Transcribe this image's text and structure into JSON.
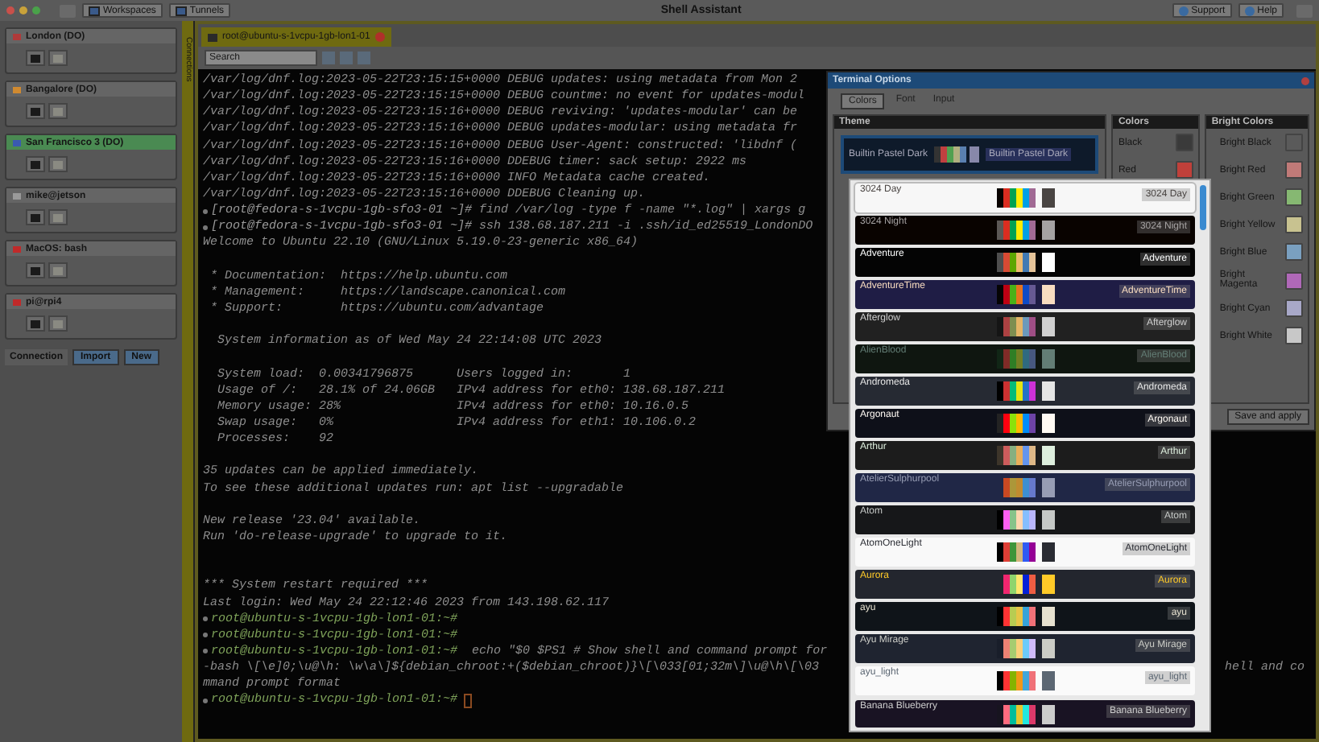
{
  "window": {
    "title": "Shell Assistant",
    "toolbar": [
      "Workspaces",
      "Tunnels"
    ],
    "actions": [
      "Support",
      "Help"
    ]
  },
  "sidebar": {
    "strip_label": "Connections",
    "connections": [
      {
        "name": "London (DO)",
        "selected": false,
        "color": "#b03a3a"
      },
      {
        "name": "Bangalore (DO)",
        "selected": false,
        "color": "#d08a30"
      },
      {
        "name": "San Francisco 3 (DO)",
        "selected": true,
        "color": "#3a5ab0"
      },
      {
        "name": "mike@jetson",
        "selected": false,
        "color": "#9a9a9a"
      },
      {
        "name": "MacOS: bash",
        "selected": false,
        "color": "#c02a2a"
      },
      {
        "name": "pi@rpi4",
        "selected": false,
        "color": "#c02a2a"
      }
    ],
    "footer": {
      "label": "Connection",
      "buttons": [
        "Import",
        "New"
      ]
    }
  },
  "tab": {
    "title": "root@ubuntu-s-1vcpu-1gb-lon1-01"
  },
  "search": {
    "placeholder": "Search"
  },
  "terminal": {
    "lines": [
      {
        "text": "/var/log/dnf.log:2023-05-22T23:15:15+0000 DEBUG updates: using metadata from Mon 2"
      },
      {
        "text": "/var/log/dnf.log:2023-05-22T23:15:15+0000 DEBUG countme: no event for updates-modul"
      },
      {
        "text": "/var/log/dnf.log:2023-05-22T23:15:16+0000 DEBUG reviving: 'updates-modular' can be"
      },
      {
        "text": "/var/log/dnf.log:2023-05-22T23:15:16+0000 DEBUG updates-modular: using metadata fr"
      },
      {
        "text": "/var/log/dnf.log:2023-05-22T23:15:16+0000 DEBUG User-Agent: constructed: 'libdnf ("
      },
      {
        "text": "/var/log/dnf.log:2023-05-22T23:15:16+0000 DDEBUG timer: sack setup: 2922 ms"
      },
      {
        "text": "/var/log/dnf.log:2023-05-22T23:15:16+0000 INFO Metadata cache created."
      },
      {
        "text": "/var/log/dnf.log:2023-05-22T23:15:16+0000 DDEBUG Cleaning up."
      },
      {
        "kind": "prompt",
        "prompt": "[root@fedora-s-1vcpu-1gb-sfo3-01 ~]#",
        "color": "#9a9a9a",
        "text": "find /var/log -type f -name \"*.log\" | xargs g"
      },
      {
        "kind": "prompt",
        "prompt": "[root@fedora-s-1vcpu-1gb-sfo3-01 ~]#",
        "color": "#9a9a9a",
        "text": "ssh 138.68.187.211 -i .ssh/id_ed25519_LondonDO"
      },
      {
        "text": "Welcome to Ubuntu 22.10 (GNU/Linux 5.19.0-23-generic x86_64)"
      },
      {
        "kind": "blank"
      },
      {
        "text": " * Documentation:  https://help.ubuntu.com"
      },
      {
        "text": " * Management:     https://landscape.canonical.com"
      },
      {
        "text": " * Support:        https://ubuntu.com/advantage"
      },
      {
        "kind": "blank"
      },
      {
        "text": "  System information as of Wed May 24 22:14:08 UTC 2023"
      },
      {
        "kind": "blank"
      },
      {
        "text": "  System load:  0.00341796875      Users logged in:       1"
      },
      {
        "text": "  Usage of /:   28.1% of 24.06GB   IPv4 address for eth0: 138.68.187.211"
      },
      {
        "text": "  Memory usage: 28%                IPv4 address for eth0: 10.16.0.5"
      },
      {
        "text": "  Swap usage:   0%                 IPv4 address for eth1: 10.106.0.2"
      },
      {
        "text": "  Processes:    92"
      },
      {
        "kind": "blank"
      },
      {
        "text": "35 updates can be applied immediately."
      },
      {
        "text": "To see these additional updates run: apt list --upgradable"
      },
      {
        "kind": "blank"
      },
      {
        "text": "New release '23.04' available."
      },
      {
        "text": "Run 'do-release-upgrade' to upgrade to it."
      },
      {
        "kind": "blank"
      },
      {
        "kind": "blank"
      },
      {
        "text": "*** System restart required ***"
      },
      {
        "text": "Last login: Wed May 24 22:12:46 2023 from 143.198.62.117"
      },
      {
        "kind": "prompt",
        "prompt": "root@ubuntu-s-1vcpu-1gb-lon1-01:~#",
        "color": "#7fa35a"
      },
      {
        "kind": "prompt",
        "prompt": "root@ubuntu-s-1vcpu-1gb-lon1-01:~#",
        "color": "#7fa35a"
      },
      {
        "kind": "prompt",
        "prompt": "root@ubuntu-s-1vcpu-1gb-lon1-01:~#",
        "color": "#7fa35a",
        "text": " echo \"$0 $PS1 # Show shell and command prompt for"
      },
      {
        "text": "-bash \\[\\e]0;\\u@\\h: \\w\\a\\]${debian_chroot:+($debian_chroot)}\\[\\033[01;32m\\]\\u@\\h\\[\\03",
        "tail": "hell and co"
      },
      {
        "text": "mmand prompt format"
      },
      {
        "kind": "prompt",
        "prompt": "root@ubuntu-s-1vcpu-1gb-lon1-01:~#",
        "color": "#7fa35a",
        "cursor": true
      }
    ]
  },
  "dialog": {
    "title": "Terminal Options",
    "tabs": [
      {
        "label": "Colors",
        "selected": true
      },
      {
        "label": "Font",
        "selected": false
      },
      {
        "label": "Input",
        "selected": false
      }
    ],
    "theme": {
      "heading": "Theme",
      "name": "Builtin Pastel Dark",
      "preview": "Builtin Pastel Dark"
    },
    "colors": {
      "heading": "Colors",
      "items": [
        {
          "label": "Black",
          "color": "#3a3a3a"
        },
        {
          "label": "Red",
          "color": "#c0403a"
        }
      ]
    },
    "bright_colors": {
      "heading": "Bright Colors",
      "items": [
        {
          "label": "Bright Black",
          "color": "#5a5a5a"
        },
        {
          "label": "Bright Red",
          "color": "#c07a78"
        },
        {
          "label": "Bright Green",
          "color": "#86b872"
        },
        {
          "label": "Bright Yellow",
          "color": "#c8c290"
        },
        {
          "label": "Bright Blue",
          "color": "#7aa0c0"
        },
        {
          "label": "Bright Magenta",
          "color": "#b068b8"
        },
        {
          "label": "Bright Cyan",
          "color": "#a8a8c8"
        },
        {
          "label": "Bright White",
          "color": "#c8c8c8"
        }
      ]
    },
    "save_button": "Save and apply"
  },
  "theme_list": [
    {
      "name": "3024 Day",
      "preview": "3024 Day",
      "color": "#f7f7f7",
      "selected": true,
      "foreground": {
        "color": "#4a4543"
      },
      "swatches": [
        {
          "color": "#090300"
        },
        {
          "color": "#db2d20"
        },
        {
          "color": "#01a252"
        },
        {
          "color": "#fded02"
        },
        {
          "color": "#01a0e4"
        },
        {
          "color": "#a16a94"
        }
      ]
    },
    {
      "name": "3024 Night",
      "preview": "3024 Night",
      "color": "#090300",
      "selected": false,
      "foreground": {
        "color": "#a5a2a2"
      },
      "swatches": [
        {
          "color": "#5c5855"
        },
        {
          "color": "#db2d20"
        },
        {
          "color": "#01a252"
        },
        {
          "color": "#fded02"
        },
        {
          "color": "#01a0e4"
        },
        {
          "color": "#a16a94"
        }
      ]
    },
    {
      "name": "Adventure",
      "preview": "Adventure",
      "color": "#040404",
      "selected": false,
      "foreground": {
        "color": "#feffff"
      },
      "swatches": [
        {
          "color": "#4e4e4e"
        },
        {
          "color": "#d84a33"
        },
        {
          "color": "#5da602"
        },
        {
          "color": "#eebb6e"
        },
        {
          "color": "#417ab3"
        },
        {
          "color": "#e5c499"
        }
      ]
    },
    {
      "name": "AdventureTime",
      "preview": "AdventureTime",
      "color": "#1f1d45",
      "selected": false,
      "foreground": {
        "color": "#f8dcc0"
      },
      "swatches": [
        {
          "color": "#050404"
        },
        {
          "color": "#bd0013"
        },
        {
          "color": "#4ab118"
        },
        {
          "color": "#e7741e"
        },
        {
          "color": "#0f4ac6"
        },
        {
          "color": "#665993"
        }
      ]
    },
    {
      "name": "Afterglow",
      "preview": "Afterglow",
      "color": "#212121",
      "selected": false,
      "foreground": {
        "color": "#d0d0d0"
      },
      "swatches": [
        {
          "color": "#151515"
        },
        {
          "color": "#ac4142"
        },
        {
          "color": "#7e8e50"
        },
        {
          "color": "#e5b567"
        },
        {
          "color": "#6c99bb"
        },
        {
          "color": "#9f4e85"
        }
      ]
    },
    {
      "name": "AlienBlood",
      "preview": "AlienBlood",
      "color": "#0f1610",
      "selected": false,
      "foreground": {
        "color": "#637d75"
      },
      "swatches": [
        {
          "color": "#112616"
        },
        {
          "color": "#7f2b27"
        },
        {
          "color": "#2f7e25"
        },
        {
          "color": "#717f24"
        },
        {
          "color": "#2f6a7f"
        },
        {
          "color": "#47587f"
        }
      ]
    },
    {
      "name": "Andromeda",
      "preview": "Andromeda",
      "color": "#262a33",
      "selected": false,
      "foreground": {
        "color": "#e5e5e5"
      },
      "swatches": [
        {
          "color": "#000000"
        },
        {
          "color": "#cd3131"
        },
        {
          "color": "#05bc79"
        },
        {
          "color": "#e5e512"
        },
        {
          "color": "#2472c8"
        },
        {
          "color": "#cd31d7"
        }
      ]
    },
    {
      "name": "Argonaut",
      "preview": "Argonaut",
      "color": "#0e1019",
      "selected": false,
      "foreground": {
        "color": "#fffaf4"
      },
      "swatches": [
        {
          "color": "#232323"
        },
        {
          "color": "#ff000f"
        },
        {
          "color": "#8ce10b"
        },
        {
          "color": "#ffb900"
        },
        {
          "color": "#008df8"
        },
        {
          "color": "#6d43a6"
        }
      ]
    },
    {
      "name": "Arthur",
      "preview": "Arthur",
      "color": "#1c1c1c",
      "selected": false,
      "foreground": {
        "color": "#ddeedd"
      },
      "swatches": [
        {
          "color": "#3d352a"
        },
        {
          "color": "#cd5c5c"
        },
        {
          "color": "#86af80"
        },
        {
          "color": "#e8ae5b"
        },
        {
          "color": "#6495ed"
        },
        {
          "color": "#deb887"
        }
      ]
    },
    {
      "name": "AtelierSulphurpool",
      "preview": "AtelierSulphurpool",
      "color": "#202746",
      "selected": false,
      "foreground": {
        "color": "#979db4"
      },
      "swatches": [
        {
          "color": "#202746"
        },
        {
          "color": "#c94922"
        },
        {
          "color": "#ac9739"
        },
        {
          "color": "#c08b30"
        },
        {
          "color": "#3d8fd1"
        },
        {
          "color": "#6679cc"
        }
      ]
    },
    {
      "name": "Atom",
      "preview": "Atom",
      "color": "#161719",
      "selected": false,
      "foreground": {
        "color": "#c5c8c6"
      },
      "swatches": [
        {
          "color": "#000000"
        },
        {
          "color": "#fd5ff1"
        },
        {
          "color": "#87c38a"
        },
        {
          "color": "#ffd7b1"
        },
        {
          "color": "#85befd"
        },
        {
          "color": "#b9b6fc"
        }
      ]
    },
    {
      "name": "AtomOneLight",
      "preview": "AtomOneLight",
      "color": "#f9f9f9",
      "selected": false,
      "foreground": {
        "color": "#2a2c33"
      },
      "swatches": [
        {
          "color": "#000000"
        },
        {
          "color": "#de3e35"
        },
        {
          "color": "#3f953a"
        },
        {
          "color": "#d2b67c"
        },
        {
          "color": "#2f5af3"
        },
        {
          "color": "#950095"
        }
      ]
    },
    {
      "name": "Aurora",
      "preview": "Aurora",
      "color": "#23262e",
      "selected": false,
      "foreground": {
        "color": "#ffca28"
      },
      "swatches": [
        {
          "color": "#23262e"
        },
        {
          "color": "#f0266f"
        },
        {
          "color": "#8fd46d"
        },
        {
          "color": "#ffe66d"
        },
        {
          "color": "#0321d7"
        },
        {
          "color": "#ee5d43"
        }
      ]
    },
    {
      "name": "ayu",
      "preview": "ayu",
      "color": "#0f1419",
      "selected": false,
      "foreground": {
        "color": "#e6e1cf"
      },
      "swatches": [
        {
          "color": "#000000"
        },
        {
          "color": "#ff3333"
        },
        {
          "color": "#b8cc52"
        },
        {
          "color": "#e7c547"
        },
        {
          "color": "#36a3d9"
        },
        {
          "color": "#f07178"
        }
      ]
    },
    {
      "name": "Ayu Mirage",
      "preview": "Ayu Mirage",
      "color": "#1f2430",
      "selected": false,
      "foreground": {
        "color": "#cbccc6"
      },
      "swatches": [
        {
          "color": "#191e2a"
        },
        {
          "color": "#ed8274"
        },
        {
          "color": "#a6cc70"
        },
        {
          "color": "#fad07b"
        },
        {
          "color": "#6dcbfa"
        },
        {
          "color": "#cfbafa"
        }
      ]
    },
    {
      "name": "ayu_light",
      "preview": "ayu_light",
      "color": "#fafafa",
      "selected": false,
      "foreground": {
        "color": "#5c6773"
      },
      "swatches": [
        {
          "color": "#000000"
        },
        {
          "color": "#ff3333"
        },
        {
          "color": "#86b300"
        },
        {
          "color": "#f29718"
        },
        {
          "color": "#41a6d9"
        },
        {
          "color": "#f07178"
        }
      ]
    },
    {
      "name": "Banana Blueberry",
      "preview": "Banana Blueberry",
      "color": "#191323",
      "selected": false,
      "foreground": {
        "color": "#cccccc"
      },
      "swatches": [
        {
          "color": "#17141f"
        },
        {
          "color": "#ff6b7f"
        },
        {
          "color": "#00bd9c"
        },
        {
          "color": "#e6c62f"
        },
        {
          "color": "#22e8df"
        },
        {
          "color": "#dc396a"
        }
      ]
    }
  ]
}
